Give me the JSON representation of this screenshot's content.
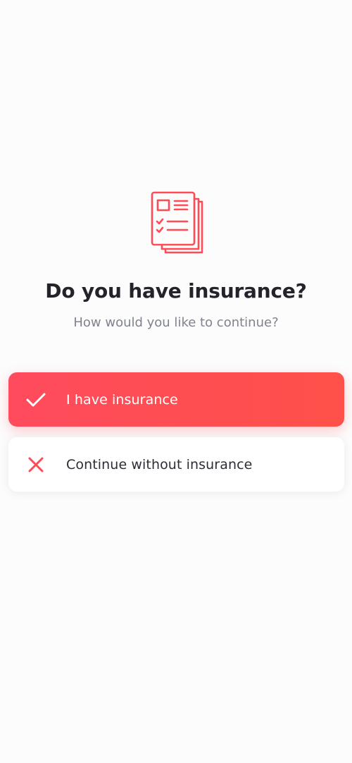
{
  "header": {
    "title": "Do you have insurance?",
    "subtitle": "How would you like to continue?",
    "icon": "insurance-document-icon"
  },
  "options": [
    {
      "label": "I have insurance",
      "icon": "checkmark-icon",
      "selected": true
    },
    {
      "label": "Continue without insurance",
      "icon": "close-icon",
      "selected": false
    }
  ],
  "colors": {
    "accent": "#ff4b55",
    "background": "#fcfcfd",
    "title": "#22232b",
    "subtitle": "#80838d"
  }
}
